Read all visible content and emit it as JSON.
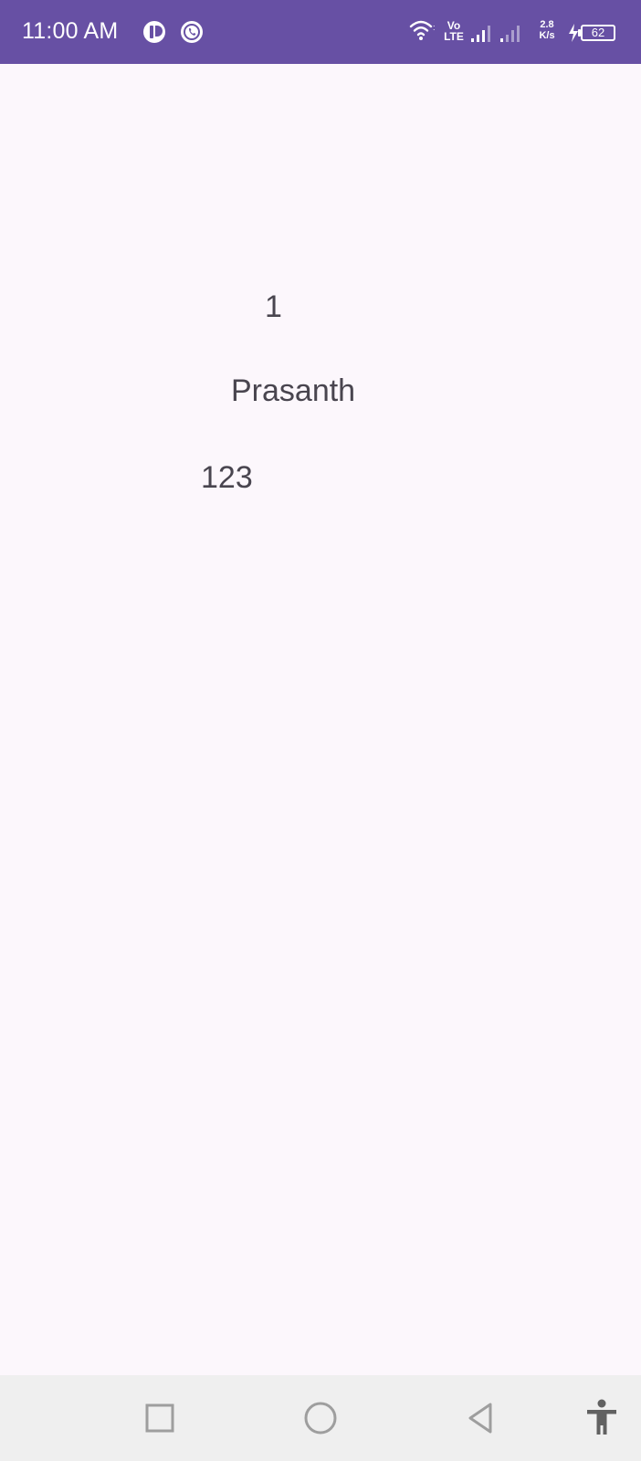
{
  "status_bar": {
    "time": "11:00 AM",
    "volte_top": "Vo",
    "volte_bottom": "LTE",
    "net_speed_value": "2.8",
    "net_speed_unit": "K/s",
    "battery_level": "62",
    "icons": [
      "app-notification-icon",
      "whatsapp-icon",
      "wifi-icon",
      "signal-icon",
      "signal-icon-2",
      "charging-icon",
      "battery-icon"
    ],
    "background_color": "#6750a4"
  },
  "content": {
    "item_number": "1",
    "name": "Prasanth",
    "code": "123",
    "text_color": "#49454f",
    "background_color": "#fcf7fc"
  },
  "nav_bar": {
    "buttons": [
      "recents-button",
      "home-button",
      "back-button",
      "accessibility-button"
    ],
    "background_color": "#efefef"
  }
}
